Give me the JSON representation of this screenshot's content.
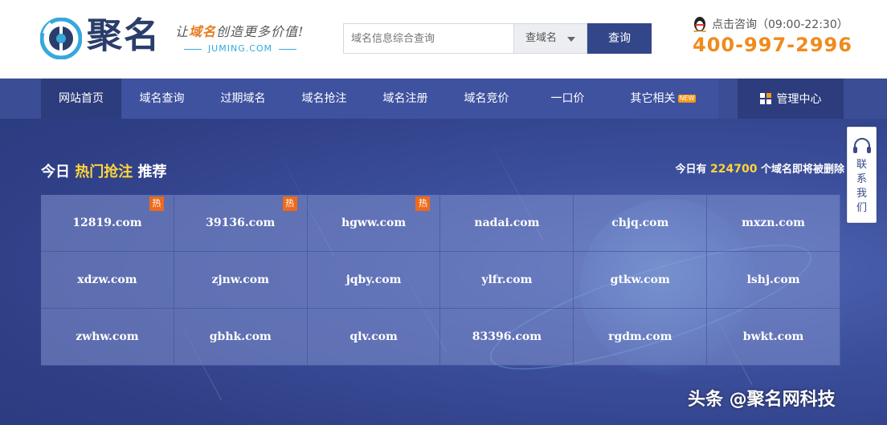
{
  "header": {
    "brand": "聚名",
    "slogan_prefix": "让",
    "slogan_highlight": "域名",
    "slogan_suffix": "创造更多价值!",
    "juming_domain": "JUMING.COM",
    "search": {
      "placeholder": "域名信息综合查询",
      "select_value": "查域名",
      "button_label": "查询"
    },
    "consult_label": "点击咨询（09:00-22:30）",
    "phone": "400-997-2996"
  },
  "nav": {
    "items": [
      {
        "label": "网站首页",
        "active": true
      },
      {
        "label": "域名查询"
      },
      {
        "label": "过期域名"
      },
      {
        "label": "域名抢注"
      },
      {
        "label": "域名注册"
      },
      {
        "label": "域名竞价"
      },
      {
        "label": "一口价"
      },
      {
        "label": "其它相关",
        "badge": "NEW"
      }
    ],
    "manage_label": "管理中心"
  },
  "section": {
    "title_prefix": "今日 ",
    "title_highlight": "热门抢注",
    "title_suffix": " 推荐",
    "count_prefix": "今日有 ",
    "count_value": "224700",
    "count_suffix": " 个域名即将被删除"
  },
  "domains": [
    {
      "name": "12819.com",
      "hot": "热"
    },
    {
      "name": "39136.com",
      "hot": "热"
    },
    {
      "name": "hgww.com",
      "hot": "热"
    },
    {
      "name": "nadai.com"
    },
    {
      "name": "chjq.com"
    },
    {
      "name": "mxzn.com"
    },
    {
      "name": "xdzw.com"
    },
    {
      "name": "zjnw.com"
    },
    {
      "name": "jqby.com"
    },
    {
      "name": "ylfr.com"
    },
    {
      "name": "gtkw.com"
    },
    {
      "name": "lshj.com"
    },
    {
      "name": "zwhw.com"
    },
    {
      "name": "gbhk.com"
    },
    {
      "name": "qlv.com"
    },
    {
      "name": "83396.com"
    },
    {
      "name": "rgdm.com"
    },
    {
      "name": "bwkt.com"
    }
  ],
  "side": {
    "label": "联系我们"
  },
  "watermark": "头条 @聚名网科技",
  "colors": {
    "accent_orange": "#f08a1c",
    "nav_blue": "#3f52a0",
    "button_blue": "#33468a",
    "highlight_yellow": "#ffd53a"
  }
}
